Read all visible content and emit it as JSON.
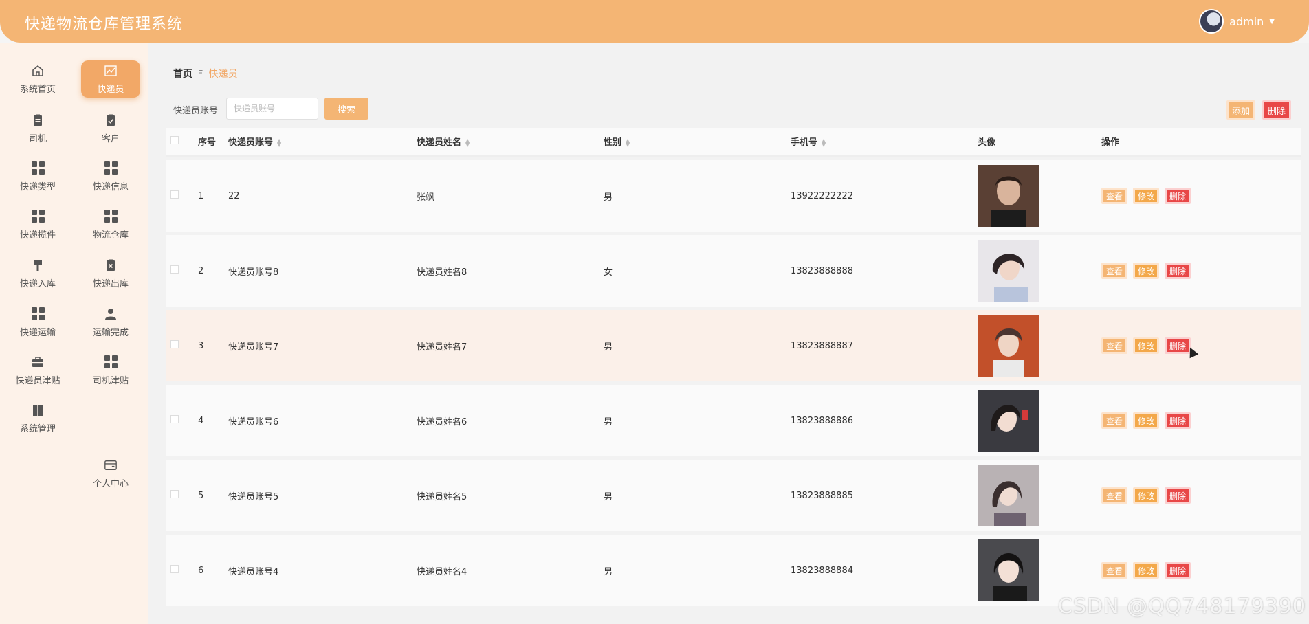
{
  "header": {
    "title": "快递物流仓库管理系统",
    "username": "admin"
  },
  "sidebar": {
    "items": [
      {
        "label": "系统首页",
        "icon": "home-icon"
      },
      {
        "label": "快递员",
        "icon": "chart-icon",
        "active": true
      },
      {
        "label": "司机",
        "icon": "clipboard-icon"
      },
      {
        "label": "客户",
        "icon": "clipboard-check-icon"
      },
      {
        "label": "快递类型",
        "icon": "grid-icon"
      },
      {
        "label": "快递信息",
        "icon": "grid-icon"
      },
      {
        "label": "快递揽件",
        "icon": "grid-icon"
      },
      {
        "label": "物流仓库",
        "icon": "grid-icon"
      },
      {
        "label": "快递入库",
        "icon": "brush-icon"
      },
      {
        "label": "快递出库",
        "icon": "clipboard-x-icon"
      },
      {
        "label": "快递运输",
        "icon": "grid-icon"
      },
      {
        "label": "运输完成",
        "icon": "user-icon"
      },
      {
        "label": "快递员津贴",
        "icon": "briefcase-icon"
      },
      {
        "label": "司机津贴",
        "icon": "grid-icon"
      },
      {
        "label": "系统管理",
        "icon": "book-icon"
      },
      {
        "label": "个人中心",
        "icon": "wallet-icon"
      }
    ]
  },
  "breadcrumb": {
    "home": "首页",
    "separator": "Ξ",
    "current": "快递员"
  },
  "search": {
    "label": "快递员账号",
    "placeholder": "快递员账号",
    "button": "搜索"
  },
  "toolbar": {
    "add": "添加",
    "delete": "删除"
  },
  "table": {
    "headers": {
      "index": "序号",
      "account": "快递员账号",
      "name": "快递员姓名",
      "sex": "性别",
      "phone": "手机号",
      "photo": "头像",
      "ops": "操作"
    },
    "op_labels": {
      "view": "查看",
      "edit": "修改",
      "delete": "删除"
    },
    "rows": [
      {
        "index": "1",
        "account": "22",
        "name": "张飒",
        "sex": "男",
        "phone": "13922222222"
      },
      {
        "index": "2",
        "account": "快递员账号8",
        "name": "快递员姓名8",
        "sex": "女",
        "phone": "13823888888"
      },
      {
        "index": "3",
        "account": "快递员账号7",
        "name": "快递员姓名7",
        "sex": "男",
        "phone": "13823888887"
      },
      {
        "index": "4",
        "account": "快递员账号6",
        "name": "快递员姓名6",
        "sex": "男",
        "phone": "13823888886"
      },
      {
        "index": "5",
        "account": "快递员账号5",
        "name": "快递员姓名5",
        "sex": "男",
        "phone": "13823888885"
      },
      {
        "index": "6",
        "account": "快递员账号4",
        "name": "快递员姓名4",
        "sex": "男",
        "phone": "13823888884"
      }
    ]
  },
  "watermark": "CSDN @QQ748179390",
  "colors": {
    "accent": "#f4b574",
    "danger": "#e84747",
    "sidebar_bg": "#fdf2e9"
  }
}
